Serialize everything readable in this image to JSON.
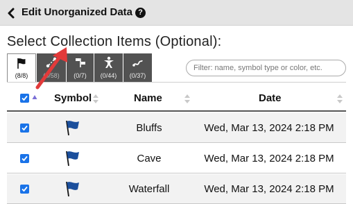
{
  "header": {
    "back_icon": "chevron-left-icon",
    "title": "Edit Unorganized Data",
    "help_icon": "question-circle-icon",
    "help_glyph": "?"
  },
  "section": {
    "title": "Select Collection Items (Optional):"
  },
  "tabs": [
    {
      "icon": "flag-icon",
      "count": "(8/8)",
      "active": true
    },
    {
      "icon": "route-icon",
      "count": "(0/58)",
      "active": false
    },
    {
      "icon": "waypoints-icon",
      "count": "(0/7)",
      "active": false
    },
    {
      "icon": "person-icon",
      "count": "(0/44)",
      "active": false
    },
    {
      "icon": "track-icon",
      "count": "(0/37)",
      "active": false
    }
  ],
  "filter": {
    "placeholder": "Filter: name, symbol type or color, etc.",
    "value": ""
  },
  "table": {
    "columns": [
      "Symbol",
      "Name",
      "Date"
    ],
    "select_all_checked": true,
    "rows": [
      {
        "checked": true,
        "symbol": "blue-flag-icon",
        "name": "Bluffs",
        "date": "Wed, Mar 13, 2024 2:18 PM"
      },
      {
        "checked": true,
        "symbol": "blue-flag-icon",
        "name": "Cave",
        "date": "Wed, Mar 13, 2024 2:18 PM"
      },
      {
        "checked": true,
        "symbol": "blue-flag-icon",
        "name": "Waterfall",
        "date": "Wed, Mar 13, 2024 2:18 PM"
      }
    ]
  },
  "colors": {
    "header_bg": "#e4e4e4",
    "tab_dark": "#525252",
    "checkbox": "#1a73e8",
    "flag": "#1b4f9c",
    "annotation_arrow": "#e23a3a",
    "sort_active": "#7b6fd6"
  }
}
